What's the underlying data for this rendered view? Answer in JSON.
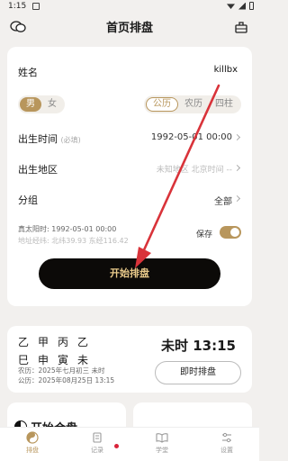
{
  "status_bar": {
    "time": "1:15"
  },
  "header": {
    "title": "首页排盘"
  },
  "form": {
    "name_label": "姓名",
    "name_value": "killbx",
    "gender_options": [
      "男",
      "女"
    ],
    "calendar_options": [
      "公历",
      "农历",
      "四柱"
    ],
    "birth_time_label": "出生时间",
    "birth_time_required": "(必填)",
    "birth_time_value": "1992-05-01 00:00",
    "birth_place_label": "出生地区",
    "birth_place_value": "未知地区 北京时间 --",
    "group_label": "分组",
    "group_value": "全部",
    "solar_time": "真太阳时:  1992-05-01 00:00",
    "coords": "地址经纬:  北纬39.93 东经116.42",
    "save_label": "保存",
    "save_on": true,
    "start_button": "开始排盘"
  },
  "bazi": {
    "row1": [
      "乙",
      "甲",
      "丙",
      "乙"
    ],
    "row2": [
      "巳",
      "申",
      "寅",
      "未"
    ],
    "lunar": "农历：2025年七月初三 未时",
    "solar": "公历：2025年08月25日 13:15",
    "current_time": "未时 13:15",
    "now_button": "即时排盘"
  },
  "cards": {
    "start_chart": "开始合盘"
  },
  "tabs": [
    {
      "label": "排盘",
      "icon": "yin-yang-icon"
    },
    {
      "label": "记录",
      "icon": "record-icon"
    },
    {
      "label": "学堂",
      "icon": "book-icon"
    },
    {
      "label": "设置",
      "icon": "settings-icon"
    }
  ],
  "colors": {
    "accent": "#b8965c",
    "button_bg": "#0c0a08",
    "button_text": "#e8c98a",
    "arrow": "#d9333a"
  }
}
